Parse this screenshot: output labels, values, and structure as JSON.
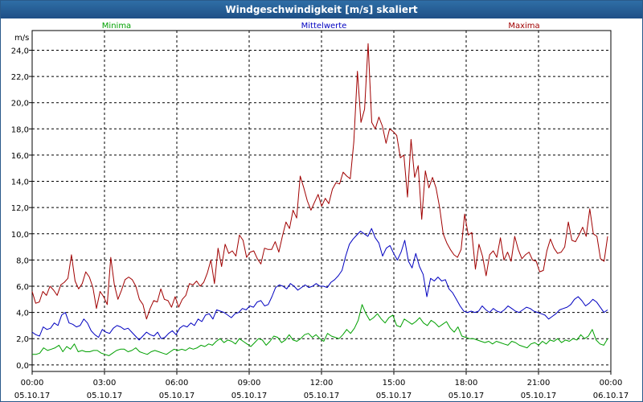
{
  "chart_data": {
    "type": "line",
    "title": "Windgeschwindigkeit [m/s] skaliert",
    "ylabel": "m/s",
    "ylim": [
      -0.5,
      25.5
    ],
    "y_ticks": [
      "0,0",
      "2,0",
      "4,0",
      "6,0",
      "8,0",
      "10,0",
      "12,0",
      "14,0",
      "16,0",
      "18,0",
      "20,0",
      "22,0",
      "24,0"
    ],
    "y_tick_values": [
      0,
      2,
      4,
      6,
      8,
      10,
      12,
      14,
      16,
      18,
      20,
      22,
      24
    ],
    "x_tick_times": [
      "00:00",
      "03:00",
      "06:00",
      "09:00",
      "12:00",
      "15:00",
      "18:00",
      "21:00",
      "00:00"
    ],
    "x_tick_dates": [
      "05.10.17",
      "05.10.17",
      "05.10.17",
      "05.10.17",
      "05.10.17",
      "05.10.17",
      "05.10.17",
      "05.10.17",
      "06.10.17"
    ],
    "grid": true,
    "legend_position": "top",
    "series": [
      {
        "name": "Minima",
        "color": "#00a000",
        "values": [
          0.8,
          0.8,
          0.9,
          1.3,
          1.1,
          1.2,
          1.3,
          1.5,
          1.0,
          1.4,
          1.2,
          1.6,
          1.0,
          1.1,
          1.0,
          1.0,
          1.1,
          1.1,
          0.9,
          0.8,
          0.7,
          0.9,
          1.1,
          1.2,
          1.2,
          1.0,
          1.1,
          1.3,
          1.0,
          0.9,
          0.8,
          1.0,
          1.1,
          1.0,
          0.9,
          0.8,
          1.0,
          1.2,
          1.1,
          1.2,
          1.1,
          1.3,
          1.2,
          1.3,
          1.5,
          1.4,
          1.6,
          1.5,
          1.8,
          2.0,
          1.7,
          1.9,
          1.8,
          1.6,
          2.0,
          1.8,
          1.6,
          1.4,
          1.7,
          2.0,
          1.9,
          1.5,
          1.8,
          2.2,
          2.1,
          1.7,
          1.9,
          2.3,
          1.9,
          1.8,
          2.0,
          2.3,
          2.4,
          2.1,
          2.3,
          2.0,
          1.8,
          2.4,
          2.2,
          2.1,
          2.0,
          2.3,
          2.7,
          2.4,
          2.8,
          3.4,
          4.6,
          3.9,
          3.4,
          3.6,
          3.9,
          3.5,
          3.2,
          3.6,
          3.8,
          3.0,
          2.9,
          3.5,
          3.3,
          3.1,
          3.3,
          3.6,
          3.2,
          3.0,
          3.4,
          3.2,
          2.9,
          3.1,
          3.3,
          2.8,
          2.5,
          2.9,
          2.2,
          2.1,
          2.0,
          2.0,
          1.9,
          1.8,
          1.7,
          1.8,
          1.6,
          1.8,
          1.7,
          1.6,
          1.5,
          1.8,
          1.7,
          1.5,
          1.4,
          1.3,
          1.6,
          1.7,
          1.5,
          1.8,
          1.6,
          1.9,
          1.8,
          2.0,
          1.7,
          1.9,
          1.8,
          2.0,
          1.9,
          2.3,
          2.0,
          2.2,
          2.7,
          1.9,
          1.6,
          1.5,
          2.0
        ]
      },
      {
        "name": "Mittelwerte",
        "color": "#0000c0",
        "values": [
          2.5,
          2.3,
          2.2,
          2.9,
          2.7,
          2.8,
          3.2,
          3.0,
          3.8,
          4.0,
          3.2,
          3.1,
          2.9,
          3.0,
          3.5,
          3.2,
          2.6,
          2.3,
          2.1,
          2.7,
          2.5,
          2.4,
          2.8,
          3.0,
          2.9,
          2.7,
          2.8,
          2.5,
          2.2,
          1.9,
          2.2,
          2.5,
          2.3,
          2.2,
          2.5,
          2.0,
          2.1,
          2.4,
          2.6,
          2.3,
          2.8,
          3.0,
          2.9,
          3.2,
          3.0,
          3.5,
          3.3,
          3.8,
          3.9,
          3.5,
          4.2,
          4.1,
          4.0,
          3.8,
          3.6,
          3.9,
          4.0,
          4.3,
          4.2,
          4.5,
          4.4,
          4.8,
          4.9,
          4.5,
          4.6,
          5.2,
          5.9,
          6.1,
          6.0,
          5.8,
          6.2,
          6.0,
          5.7,
          5.9,
          6.1,
          5.9,
          6.0,
          6.2,
          6.0,
          6.0,
          5.9,
          6.3,
          6.5,
          6.8,
          7.2,
          8.3,
          9.2,
          9.6,
          9.9,
          10.2,
          10.0,
          9.8,
          10.4,
          9.7,
          9.3,
          8.3,
          8.9,
          9.1,
          8.5,
          8.0,
          8.6,
          9.5,
          7.9,
          7.4,
          8.5,
          7.5,
          6.9,
          5.2,
          6.6,
          6.4,
          6.7,
          6.4,
          6.5,
          5.8,
          5.5,
          5.0,
          4.5,
          4.1,
          4.0,
          4.1,
          4.0,
          4.1,
          4.5,
          4.2,
          4.0,
          4.3,
          4.1,
          4.0,
          4.2,
          4.5,
          4.3,
          4.1,
          4.0,
          4.2,
          4.4,
          4.3,
          4.1,
          4.0,
          3.9,
          3.8,
          3.5,
          3.7,
          3.9,
          4.2,
          4.3,
          4.4,
          4.6,
          5.0,
          5.2,
          4.9,
          4.5,
          4.7,
          5.0,
          4.8,
          4.4,
          4.0,
          4.2
        ]
      },
      {
        "name": "Maxima",
        "color": "#a00000",
        "values": [
          5.6,
          4.7,
          4.8,
          5.6,
          5.3,
          6.0,
          5.7,
          5.3,
          6.1,
          6.3,
          6.6,
          8.4,
          6.4,
          5.8,
          6.2,
          7.1,
          6.7,
          5.9,
          4.3,
          5.6,
          5.2,
          4.6,
          8.2,
          6.1,
          5.0,
          5.7,
          6.5,
          6.7,
          6.5,
          6.0,
          5.0,
          4.6,
          3.5,
          4.3,
          4.9,
          4.8,
          5.8,
          5.0,
          4.9,
          4.4,
          5.2,
          4.4,
          5.0,
          5.3,
          6.2,
          6.1,
          6.4,
          6.0,
          6.3,
          7.0,
          8.0,
          6.2,
          8.9,
          7.5,
          9.2,
          8.5,
          8.7,
          8.3,
          9.9,
          9.5,
          8.2,
          8.6,
          8.7,
          8.1,
          7.7,
          8.9,
          8.8,
          8.8,
          9.4,
          8.6,
          9.8,
          10.9,
          10.4,
          11.8,
          11.2,
          14.4,
          13.5,
          12.5,
          11.8,
          12.4,
          13.0,
          12.1,
          12.7,
          12.3,
          13.4,
          13.9,
          13.8,
          14.7,
          14.4,
          14.2,
          17.0,
          22.4,
          18.5,
          19.5,
          24.5,
          18.5,
          18.0,
          18.9,
          18.2,
          16.9,
          18.0,
          17.8,
          17.5,
          15.8,
          16.0,
          12.8,
          17.2,
          14.3,
          15.2,
          11.1,
          14.8,
          13.5,
          14.3,
          13.5,
          12.0,
          10.0,
          9.3,
          8.8,
          8.4,
          8.2,
          8.8,
          11.5,
          9.9,
          10.1,
          7.3,
          9.2,
          8.3,
          6.8,
          8.4,
          8.7,
          8.2,
          9.7,
          8.0,
          8.6,
          7.9,
          9.8,
          8.8,
          8.1,
          8.4,
          8.6,
          8.0,
          7.9,
          7.1,
          7.2,
          8.7,
          9.6,
          8.9,
          8.5,
          8.6,
          9.0,
          10.9,
          9.5,
          9.4,
          9.9,
          10.5,
          9.8,
          11.9,
          10.0,
          9.8,
          8.1,
          7.9,
          9.8
        ]
      }
    ]
  }
}
